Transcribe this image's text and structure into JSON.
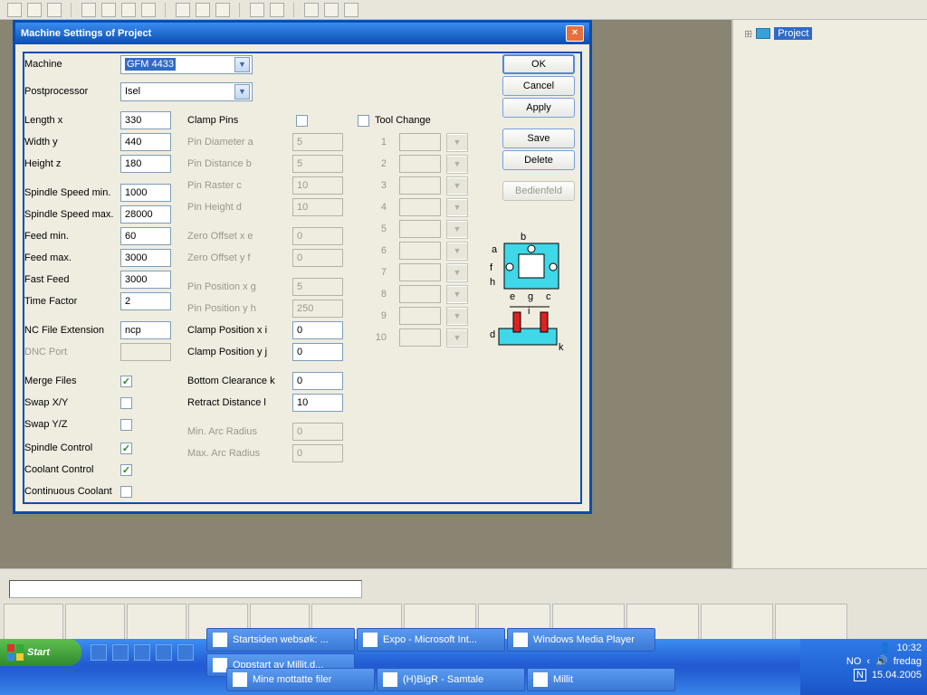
{
  "topbar_icons": [
    "file",
    "save",
    "print",
    "|",
    "t1",
    "t2",
    "t3",
    "|",
    "a",
    "b",
    "c",
    "|",
    "x",
    "y",
    "|",
    "p",
    "q",
    "r",
    "s"
  ],
  "tree": {
    "root_label": "Project"
  },
  "dialog": {
    "title": "Machine Settings of Project",
    "buttons": {
      "ok": "OK",
      "cancel": "Cancel",
      "apply": "Apply",
      "save": "Save",
      "delete": "Delete",
      "bedien": "Bedienfeld"
    },
    "machine": {
      "label": "Machine",
      "value": "GFM 4433"
    },
    "postproc": {
      "label": "Postprocessor",
      "value": "Isel"
    },
    "lengthx": {
      "label": "Length x",
      "value": "330"
    },
    "widthy": {
      "label": "Width y",
      "value": "440"
    },
    "heightz": {
      "label": "Height z",
      "value": "180"
    },
    "ssmin": {
      "label": "Spindle Speed min.",
      "value": "1000"
    },
    "ssmax": {
      "label": "Spindle Speed max.",
      "value": "28000"
    },
    "feedmin": {
      "label": "Feed min.",
      "value": "60"
    },
    "feedmax": {
      "label": "Feed max.",
      "value": "3000"
    },
    "fastfeed": {
      "label": "Fast Feed",
      "value": "3000"
    },
    "timefactor": {
      "label": "Time Factor",
      "value": "2"
    },
    "ncext": {
      "label": "NC File Extension",
      "value": "ncp"
    },
    "dncport": {
      "label": "DNC Port",
      "value": ""
    },
    "merge": {
      "label": "Merge Files",
      "checked": true
    },
    "swapxy": {
      "label": "Swap X/Y",
      "checked": false
    },
    "swapyz": {
      "label": "Swap Y/Z",
      "checked": false
    },
    "spctrl": {
      "label": "Spindle Control",
      "checked": true
    },
    "coolctrl": {
      "label": "Coolant Control",
      "checked": true
    },
    "contcool": {
      "label": "Continuous Coolant",
      "checked": false
    },
    "clamppins": {
      "label": "Clamp Pins",
      "checked": false
    },
    "pind": {
      "label": "Pin Diameter a",
      "value": "5"
    },
    "pindist": {
      "label": "Pin Distance b",
      "value": "5"
    },
    "pinrast": {
      "label": "Pin Raster c",
      "value": "10"
    },
    "pinh": {
      "label": "Pin Height d",
      "value": "10"
    },
    "zox": {
      "label": "Zero Offset x e",
      "value": "0"
    },
    "zoy": {
      "label": "Zero Offset y f",
      "value": "0"
    },
    "ppx": {
      "label": "Pin Position x g",
      "value": "5"
    },
    "ppy": {
      "label": "Pin Position y h",
      "value": "250"
    },
    "cpx": {
      "label": "Clamp Position x i",
      "value": "0"
    },
    "cpy": {
      "label": "Clamp Position y j",
      "value": "0"
    },
    "botk": {
      "label": "Bottom Clearance k",
      "value": "0"
    },
    "retl": {
      "label": "Retract Distance l",
      "value": "10"
    },
    "minarc": {
      "label": "Min. Arc Radius",
      "value": "0"
    },
    "maxarc": {
      "label": "Max. Arc Radius",
      "value": "0"
    },
    "toolchange": {
      "label": "Tool Change",
      "checked": false
    },
    "slots": [
      "1",
      "2",
      "3",
      "4",
      "5",
      "6",
      "7",
      "8",
      "9",
      "10"
    ]
  },
  "taskbar": {
    "start": "Start",
    "tasks": [
      "Startsiden websøk: ...",
      "Expo - Microsoft Int...",
      "Windows Media Player",
      "Oppstart av Millit.d...",
      "Mine mottatte filer",
      "(H)BigR - Samtale",
      "Millit"
    ],
    "lang": "NO",
    "time": "10:32",
    "day": "fredag",
    "date": "15.04.2005"
  }
}
